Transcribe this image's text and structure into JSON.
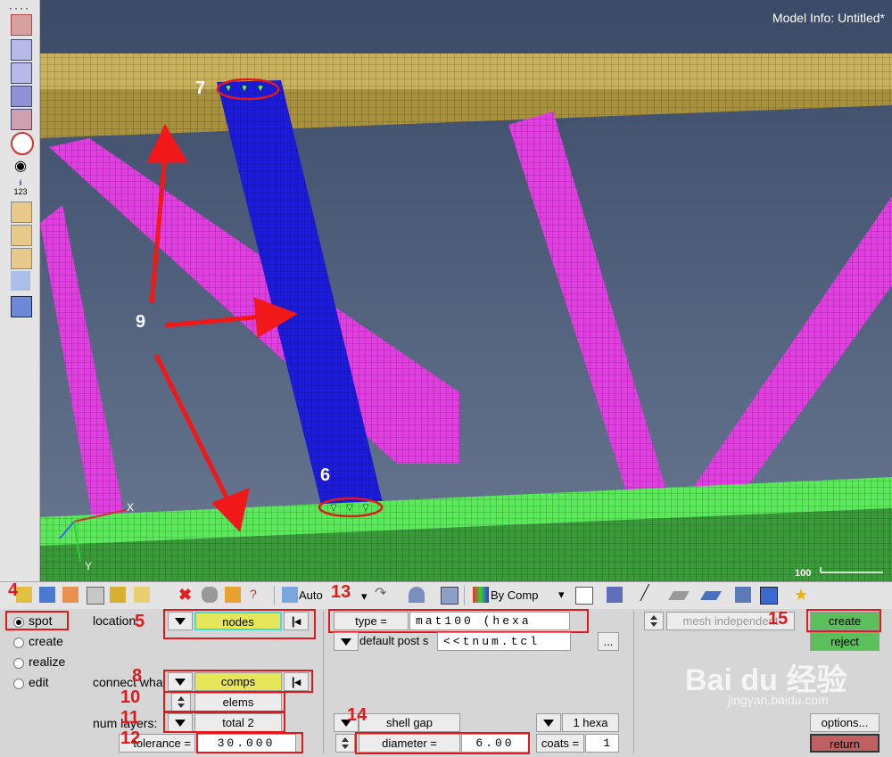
{
  "viewport": {
    "model_info": "Model Info: Untitled*",
    "scale_label": "100",
    "annotations": {
      "n6": "6",
      "n7": "7",
      "n9": "9"
    },
    "axis": {
      "x": "X",
      "y": "Y"
    }
  },
  "toolbar": {
    "auto_label": "Auto",
    "bycomp_label": "By Comp"
  },
  "panel": {
    "radios": [
      {
        "label": "spot",
        "selected": true
      },
      {
        "label": "create",
        "selected": false
      },
      {
        "label": "realize",
        "selected": false
      },
      {
        "label": "edit",
        "selected": false
      }
    ],
    "location_label": "location",
    "location_value": "nodes",
    "connect_label": "connect wha",
    "connect_value": "comps",
    "elems_value": "elems",
    "num_layers_label": "num layers:",
    "num_layers_value": "total 2",
    "tolerance_label": "tolerance =",
    "tolerance_value": "30.000",
    "type_label": "type =",
    "type_value": "mat100 (hexa",
    "default_post_label": "default post s",
    "default_post_value": "<<tnum.tcl",
    "browse_label": "...",
    "shell_gap_label": "shell gap",
    "diameter_label": "diameter =",
    "diameter_value": "6.00",
    "mesh_indep_label": "mesh independent",
    "hexa_label": "1 hexa",
    "coats_label": "coats =",
    "coats_value": "1",
    "create_label": "create",
    "reject_label": "reject",
    "options_label": "options...",
    "return_label": "return"
  },
  "annotations": {
    "n4": "4",
    "n5": "5",
    "n8": "8",
    "n10": "10",
    "n11": "11",
    "n12": "12",
    "n13": "13",
    "n14": "14",
    "n15": "15"
  },
  "watermark": {
    "brand": "Bai du 经验",
    "url": "jingyan.baidu.com"
  },
  "colors": {
    "accent_red": "#e0191c",
    "create_green": "#5bbf5b",
    "return_red": "#c06060",
    "highlight_yellow": "#e6e65a"
  }
}
